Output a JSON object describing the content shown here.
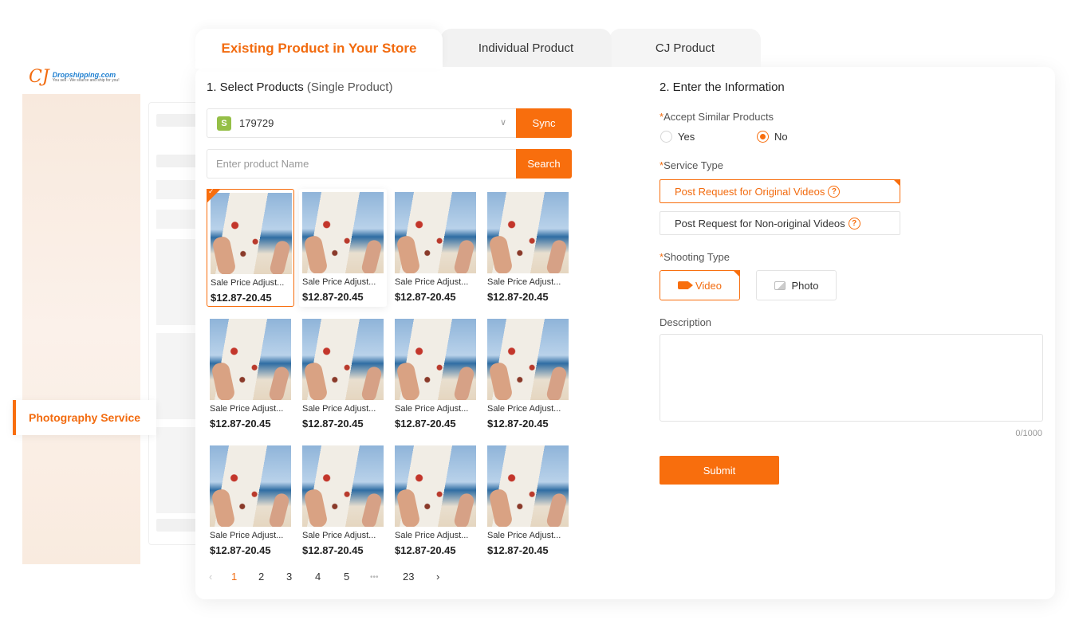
{
  "brand": {
    "logo_mark": "CJ",
    "name": "Dropshipping.com",
    "tagline": "You sell - We source and ship for you!"
  },
  "sidebar_tag": "Photography Service",
  "tabs": [
    {
      "label": "Existing Product in Your Store",
      "active": true
    },
    {
      "label": "Individual Product",
      "active": false
    },
    {
      "label": "CJ Product",
      "active": false
    }
  ],
  "left": {
    "title": "1. Select Products",
    "title_sub": "(Single Product)",
    "store_value": "179729",
    "sync_label": "Sync",
    "search_placeholder": "Enter product Name",
    "search_label": "Search",
    "products": [
      {
        "name": "Sale Price Adjust...",
        "price": "$12.87-20.45",
        "selected": true
      },
      {
        "name": "Sale Price Adjust...",
        "price": "$12.87-20.45"
      },
      {
        "name": "Sale Price Adjust...",
        "price": "$12.87-20.45"
      },
      {
        "name": "Sale Price Adjust...",
        "price": "$12.87-20.45"
      },
      {
        "name": "Sale Price Adjust...",
        "price": "$12.87-20.45"
      },
      {
        "name": "Sale Price Adjust...",
        "price": "$12.87-20.45"
      },
      {
        "name": "Sale Price Adjust...",
        "price": "$12.87-20.45"
      },
      {
        "name": "Sale Price Adjust...",
        "price": "$12.87-20.45"
      },
      {
        "name": "Sale Price Adjust...",
        "price": "$12.87-20.45"
      },
      {
        "name": "Sale Price Adjust...",
        "price": "$12.87-20.45"
      },
      {
        "name": "Sale Price Adjust...",
        "price": "$12.87-20.45"
      },
      {
        "name": "Sale Price Adjust...",
        "price": "$12.87-20.45"
      }
    ],
    "pagination": {
      "prev": "‹",
      "pages": [
        "1",
        "2",
        "3",
        "4",
        "5"
      ],
      "ellipsis": "•••",
      "last": "23",
      "next": "›",
      "current": "1"
    }
  },
  "right": {
    "title": "2. Enter the Information",
    "required_mark": "*",
    "accept_label": "Accept Similar Products",
    "accept_yes": "Yes",
    "accept_no": "No",
    "accept_selected": "No",
    "service_label": "Service Type",
    "service_options": [
      "Post Request for Original Videos",
      "Post Request for Non-original Videos"
    ],
    "service_selected": "Post Request for Original Videos",
    "shooting_label": "Shooting Type",
    "shooting_video": "Video",
    "shooting_photo": "Photo",
    "shooting_selected": "Video",
    "description_label": "Description",
    "description_value": "",
    "counter": "0/1000",
    "submit_label": "Submit"
  },
  "colors": {
    "accent": "#f86e0d",
    "accent_text": "#f26b0f"
  }
}
